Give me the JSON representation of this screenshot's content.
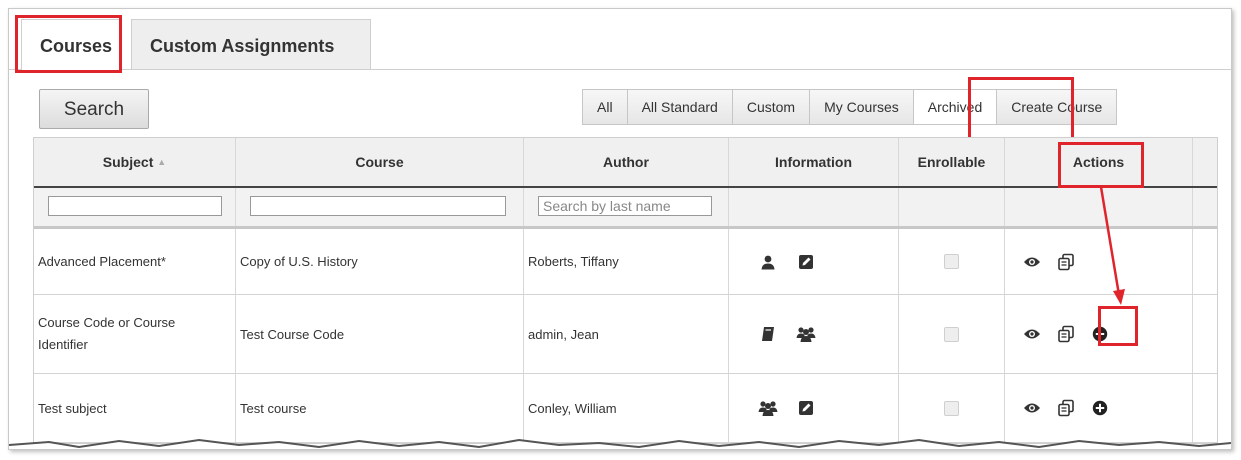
{
  "tabs": [
    {
      "label": "Courses",
      "active": true
    },
    {
      "label": "Custom Assignments",
      "active": false
    }
  ],
  "toolbar": {
    "search_label": "Search",
    "filters": [
      {
        "label": "All",
        "active": false
      },
      {
        "label": "All Standard",
        "active": false
      },
      {
        "label": "Custom",
        "active": false
      },
      {
        "label": "My Courses",
        "active": false
      },
      {
        "label": "Archived",
        "active": true
      },
      {
        "label": "Create Course",
        "active": false
      }
    ]
  },
  "table": {
    "columns": [
      "Subject",
      "Course",
      "Author",
      "Information",
      "Enrollable",
      "Actions"
    ],
    "sort_indicator": "▲",
    "author_filter_placeholder": "Search by last name",
    "rows": [
      {
        "subject": "Advanced Placement*",
        "course": "Copy of U.S. History",
        "author": "Roberts, Tiffany",
        "info_icons": [
          "user-icon",
          "edit-note-icon"
        ],
        "enrollable": false,
        "actions": [
          "view-eye-icon",
          "copy-icon"
        ]
      },
      {
        "subject": "Course Code or Course Identifier",
        "course": "Test Course Code",
        "author": "admin, Jean",
        "info_icons": [
          "book-icon",
          "group-icon"
        ],
        "enrollable": false,
        "actions": [
          "view-eye-icon",
          "copy-icon",
          "add-circle-icon"
        ]
      },
      {
        "subject": "Test subject",
        "course": "Test course",
        "author": "Conley, William",
        "info_icons": [
          "group-icon",
          "edit-note-icon"
        ],
        "enrollable": false,
        "actions": [
          "view-eye-icon",
          "copy-icon",
          "add-circle-icon"
        ]
      }
    ]
  },
  "colors": {
    "highlight": "#e0242c",
    "icon": "#333333"
  }
}
